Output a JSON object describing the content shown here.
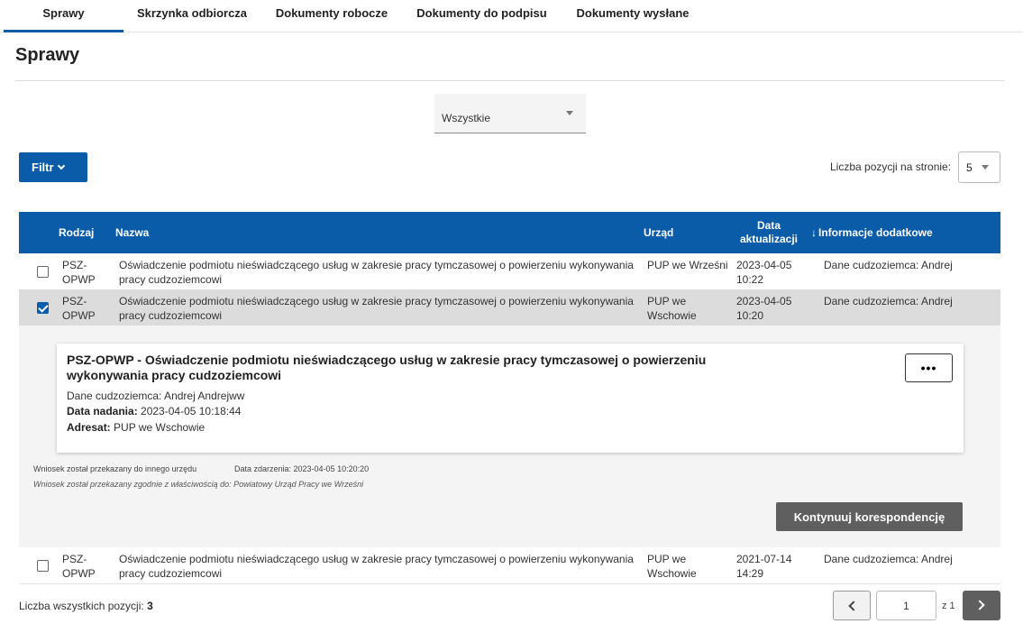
{
  "tabs": [
    {
      "label": "Sprawy",
      "active": true
    },
    {
      "label": "Skrzynka odbiorcza"
    },
    {
      "label": "Dokumenty robocze"
    },
    {
      "label": "Dokumenty do podpisu"
    },
    {
      "label": "Dokumenty wysłane"
    }
  ],
  "page": {
    "title": "Sprawy"
  },
  "filter": {
    "status_selected": "Wszystkie",
    "button_label": "Filtr"
  },
  "pagination_top": {
    "label": "Liczba pozycji na stronie:",
    "value": "5"
  },
  "table": {
    "headers": {
      "rodzaj": "Rodzaj",
      "nazwa": "Nazwa",
      "urzad": "Urząd",
      "data_line1": "Data",
      "data_line2": "aktualizacji",
      "sort_arrow": "↓",
      "info": "Informacje dodatkowe"
    },
    "rows": [
      {
        "rodzaj": [
          "PSZ-",
          "OPWP"
        ],
        "nazwa": [
          "Oświadczenie podmiotu nieświadczącego usług w zakresie pracy tymczasowej o powierzeniu wykonywania",
          "pracy cudzoziemcowi"
        ],
        "urzad": [
          "PUP we Wrześni",
          ""
        ],
        "data": [
          "2023-04-05",
          "10:22"
        ],
        "info": "Dane cudzoziemca: Andrej",
        "checked": false
      },
      {
        "rodzaj": [
          "PSZ-",
          "OPWP"
        ],
        "nazwa": [
          "Oświadczenie podmiotu nieświadczącego usług w zakresie pracy tymczasowej o powierzeniu wykonywania",
          "pracy cudzoziemcowi"
        ],
        "urzad": [
          "PUP we",
          "Wschowie"
        ],
        "data": [
          "2023-04-05",
          "10:20"
        ],
        "info": "Dane cudzoziemca: Andrej",
        "checked": true
      },
      {
        "rodzaj": [
          "PSZ-",
          "OPWP"
        ],
        "nazwa": [
          "Oświadczenie podmiotu nieświadczącego usług w zakresie pracy tymczasowej o powierzeniu wykonywania",
          "pracy cudzoziemcowi"
        ],
        "urzad": [
          "PUP we",
          "Wschowie"
        ],
        "data": [
          "2021-07-14",
          "14:29"
        ],
        "info": "Dane cudzoziemca: Andrej",
        "checked": false
      }
    ]
  },
  "detail": {
    "title_line1": "PSZ-OPWP - Oświadczenie podmiotu nieświadczącego usług w zakresie pracy tymczasowej o powierzeniu",
    "title_line2": "wykonywania pracy cudzoziemcowi",
    "foreigner": "Dane cudzoziemca: Andrej Andrejww",
    "sent_label": "Data nadania:",
    "sent_value": "2023-04-05 10:18:44",
    "addressee_label": "Adresat:",
    "addressee_value": "PUP we Wschowie",
    "more_label": "•••",
    "event_status": "Wniosek został przekazany do innego urzędu",
    "event_date": "Data zdarzenia: 2023-04-05 10:20:20",
    "event_note": "Wniosek został przekazany zgodnie z właściwością do: Powiatowy Urząd Pracy we Wrześni",
    "continue_label": "Kontynuuj korespondencję"
  },
  "footer": {
    "total_label": "Liczba wszystkich pozycji:",
    "total_value": "3",
    "current_page": "1",
    "of_label": "z 1"
  }
}
